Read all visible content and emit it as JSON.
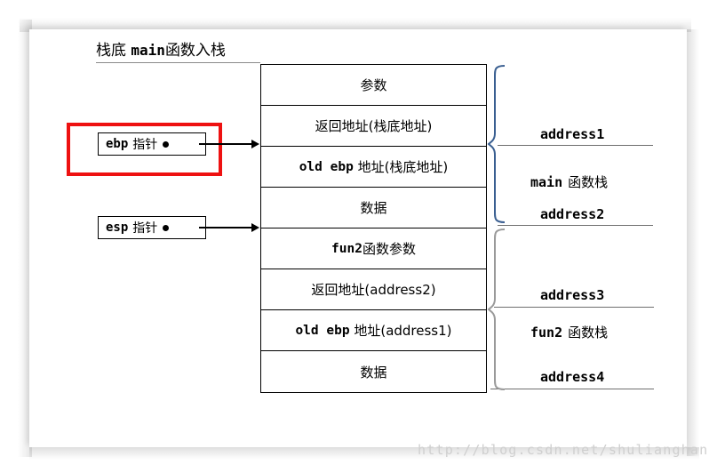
{
  "diagram": {
    "title_cjk_1": "栈底",
    "title_mono": "main",
    "title_cjk_2": "函数入栈",
    "title_full": "栈底 main函数入栈"
  },
  "pointers": [
    {
      "name": "ebp",
      "mono": "ebp",
      "cjk": "指针",
      "label": "ebp 指针",
      "highlighted": true,
      "highlight_color": "#ee1111"
    },
    {
      "name": "esp",
      "mono": "esp",
      "cjk": "指针",
      "label": "esp 指针",
      "highlighted": false
    }
  ],
  "stack_rows": [
    {
      "id": "row-1",
      "text": "参数",
      "mono": "",
      "cjk": "参数"
    },
    {
      "id": "row-2",
      "text": "返回地址(栈底地址)",
      "mono": "",
      "cjk": "返回地址(栈底地址)"
    },
    {
      "id": "row-3",
      "text": "old ebp 地址(栈底地址)",
      "mono": "old ebp",
      "cjk": "地址(栈底地址)"
    },
    {
      "id": "row-4",
      "text": "数据",
      "mono": "",
      "cjk": "数据"
    },
    {
      "id": "row-5",
      "text": "fun2函数参数",
      "mono": "fun2",
      "cjk": "函数参数"
    },
    {
      "id": "row-6",
      "text": "返回地址(address2)",
      "mono": "",
      "cjk": "返回地址(address2)"
    },
    {
      "id": "row-7",
      "text": "old ebp 地址(address1)",
      "mono": "old ebp",
      "cjk": "地址(address1)"
    },
    {
      "id": "row-8",
      "text": "数据",
      "mono": "",
      "cjk": "数据"
    }
  ],
  "addresses": [
    {
      "id": "address1",
      "label": "address1"
    },
    {
      "id": "address2",
      "label": "address2"
    },
    {
      "id": "address3",
      "label": "address3"
    },
    {
      "id": "address4",
      "label": "address4"
    }
  ],
  "groups": [
    {
      "id": "main-frame",
      "mono": "main",
      "cjk": "函数栈",
      "label": "main 函数栈",
      "brace_color": "#3a5f91"
    },
    {
      "id": "fun2-frame",
      "mono": "fun2",
      "cjk": "函数栈",
      "label": "fun2 函数栈",
      "brace_color": "#9a9a9a"
    }
  ],
  "watermark": {
    "text": "http://blog.csdn.net/shulianghan"
  }
}
